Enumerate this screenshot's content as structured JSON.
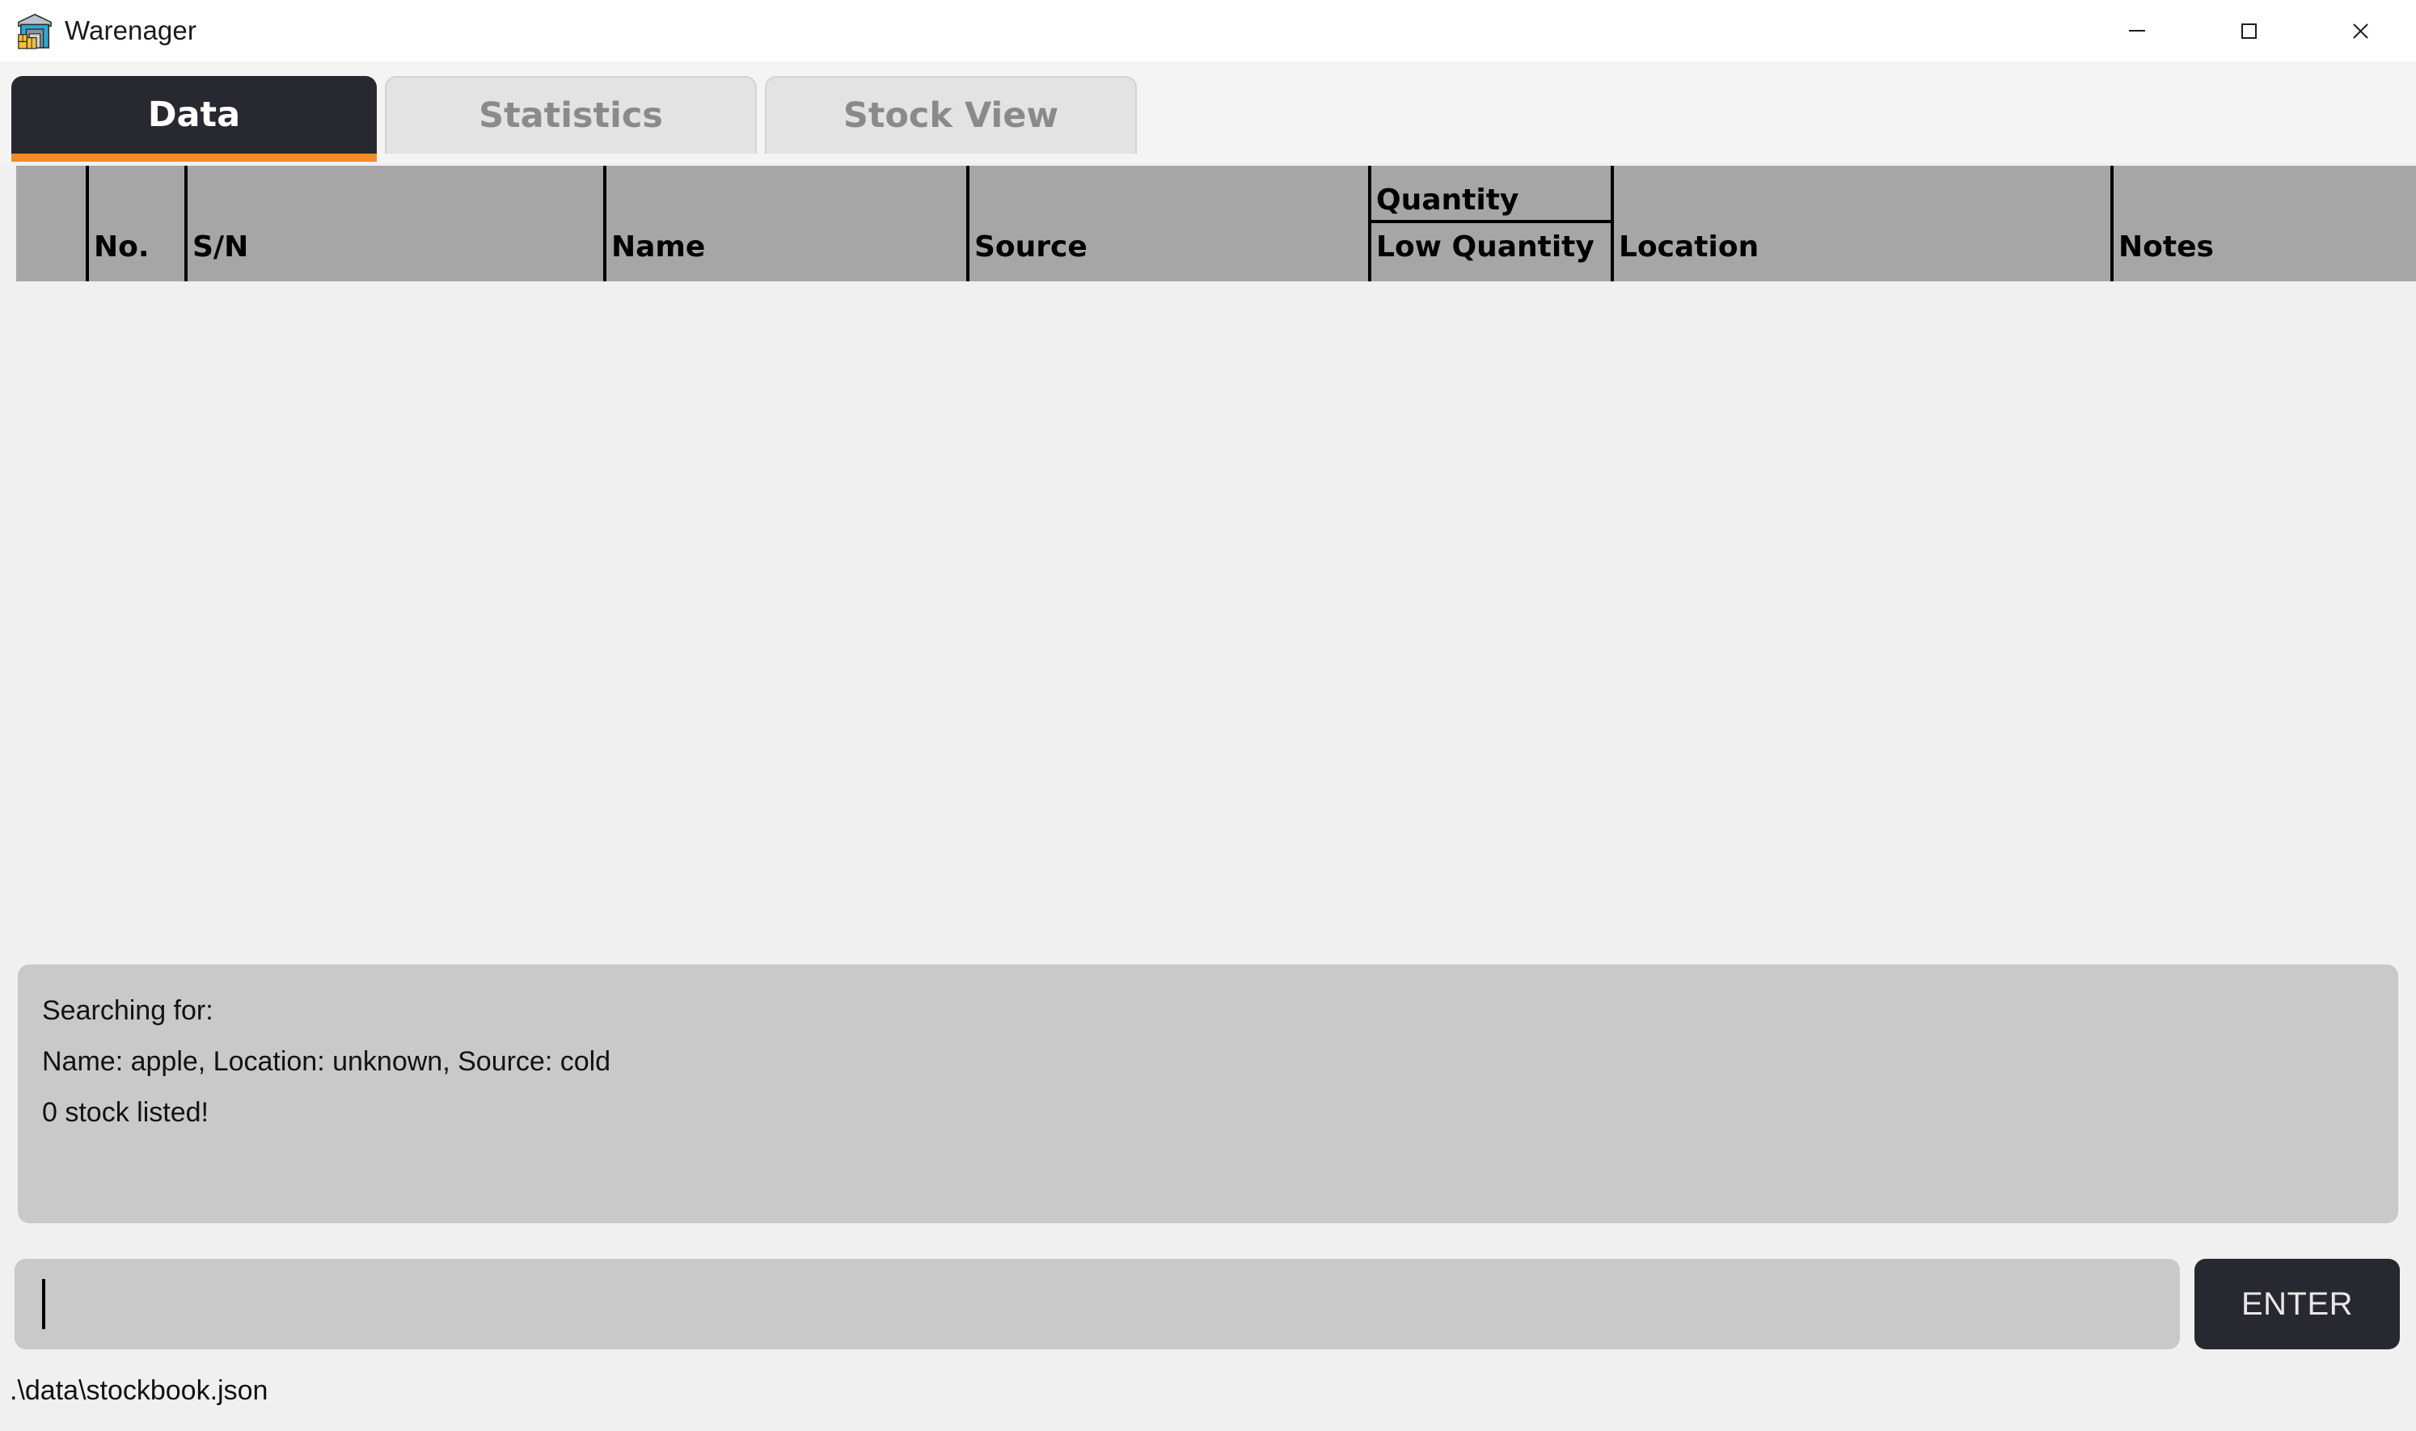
{
  "window": {
    "title": "Warenager",
    "icon": "warehouse-icon",
    "controls": {
      "minimize": "minimize-icon",
      "maximize": "maximize-icon",
      "close": "close-icon"
    }
  },
  "tabs": [
    {
      "label": "Data",
      "active": true
    },
    {
      "label": "Statistics",
      "active": false
    },
    {
      "label": "Stock View",
      "active": false
    }
  ],
  "table": {
    "columns": [
      {
        "label": ""
      },
      {
        "label": "No."
      },
      {
        "label": "S/N"
      },
      {
        "label": "Name"
      },
      {
        "label": "Source"
      },
      {
        "label": "Quantity",
        "sub_label": "Low Quantity"
      },
      {
        "label": "Location"
      },
      {
        "label": "Notes"
      }
    ],
    "rows": []
  },
  "status": {
    "lines": [
      "Searching for:",
      "Name: apple, Location: unknown, Source: cold",
      "0 stock listed!"
    ]
  },
  "command_input": {
    "value": "",
    "placeholder": ""
  },
  "enter_button": {
    "label": "ENTER"
  },
  "footer": {
    "file_path": ".\\data\\stockbook.json"
  },
  "colors": {
    "accent": "#f28c28",
    "active_tab_bg": "#282830",
    "inactive_tab_bg": "#e3e3e3",
    "header_bg": "#a6a6a6",
    "panel_bg": "#c9c9c9",
    "window_bg": "#f0f0f0"
  }
}
